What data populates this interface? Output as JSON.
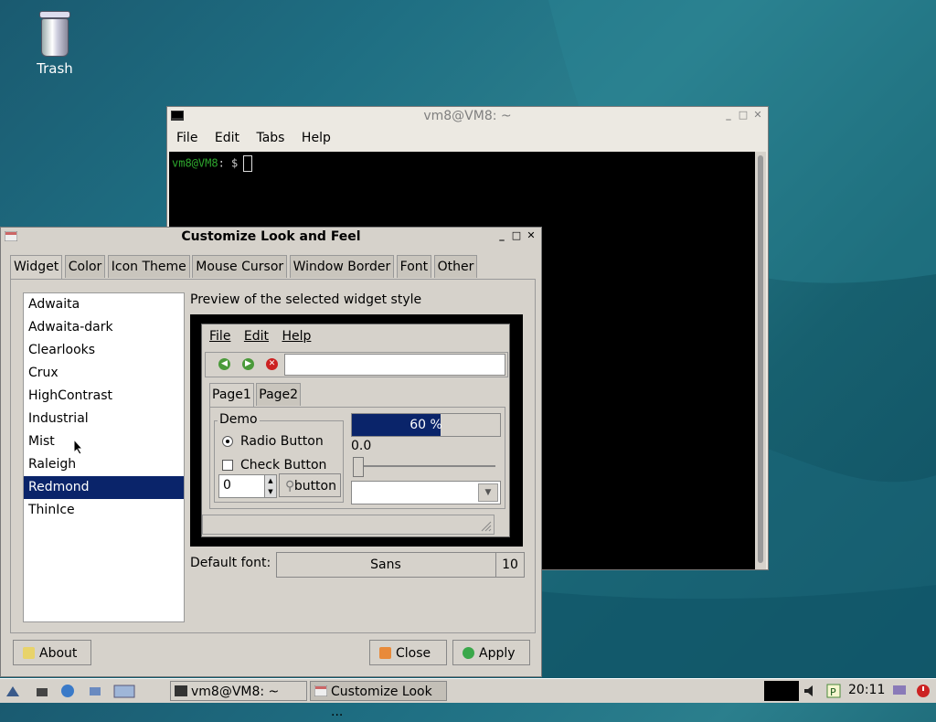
{
  "desktop": {
    "trash_label": "Trash"
  },
  "terminal": {
    "title": "vm8@VM8: ~",
    "menu": [
      "File",
      "Edit",
      "Tabs",
      "Help"
    ],
    "prompt_user": "vm8@VM8",
    "prompt_rest": ": $"
  },
  "customize": {
    "title": "Customize Look and Feel",
    "tabs": [
      "Widget",
      "Color",
      "Icon Theme",
      "Mouse Cursor",
      "Window Border",
      "Font",
      "Other"
    ],
    "themes": [
      "Adwaita",
      "Adwaita-dark",
      "Clearlooks",
      "Crux",
      "HighContrast",
      "Industrial",
      "Mist",
      "Raleigh",
      "Redmond",
      "ThinIce"
    ],
    "selected_theme": "Redmond",
    "preview_label": "Preview of the selected widget style",
    "preview": {
      "menu": [
        "File",
        "Edit",
        "Help"
      ],
      "tabs": [
        "Page1",
        "Page2"
      ],
      "demo_label": "Demo",
      "radio_label": "Radio Button",
      "check_label": "Check Button",
      "spin_value": "0",
      "button_label": "button",
      "progress_text": "60 %",
      "progress_fraction": 0.6,
      "slider_value": "0.0"
    },
    "default_font_label": "Default font:",
    "font_name": "Sans",
    "font_size": "10",
    "about_label": "About",
    "close_label": "Close",
    "apply_label": "Apply"
  },
  "taskbar": {
    "tasks": [
      "vm8@VM8: ~",
      "Customize Look ..."
    ],
    "clock": "20:11"
  },
  "colors": {
    "selection": "#0a246a",
    "window_bg": "#d6d2cb"
  }
}
